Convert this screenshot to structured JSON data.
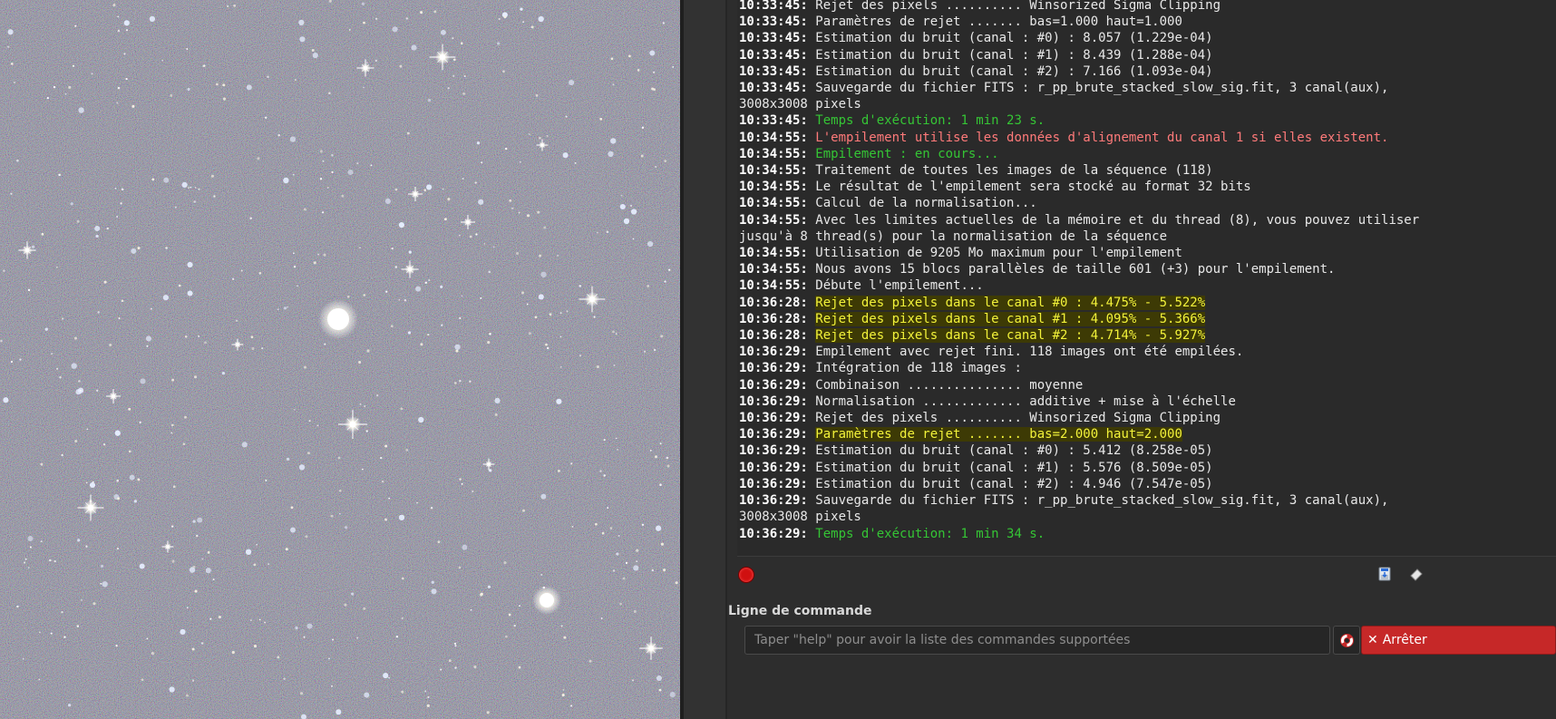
{
  "log": [
    {
      "ts": "10:33:45:",
      "msg": "Rejet des pixels .......... Winsorized Sigma Clipping",
      "style": "normal"
    },
    {
      "ts": "10:33:45:",
      "msg": "Paramètres de rejet ....... bas=1.000 haut=1.000",
      "style": "normal"
    },
    {
      "ts": "10:33:45:",
      "msg": "Estimation du bruit (canal : #0) : 8.057 (1.229e-04)",
      "style": "normal"
    },
    {
      "ts": "10:33:45:",
      "msg": "Estimation du bruit (canal : #1) : 8.439 (1.288e-04)",
      "style": "normal"
    },
    {
      "ts": "10:33:45:",
      "msg": "Estimation du bruit (canal : #2) : 7.166 (1.093e-04)",
      "style": "normal"
    },
    {
      "ts": "10:33:45:",
      "msg": "Sauvegarde du fichier FITS : r_pp_brute_stacked_slow_sig.fit, 3 canal(aux),",
      "style": "normal"
    },
    {
      "ts": "",
      "msg": "3008x3008 pixels",
      "style": "normal"
    },
    {
      "ts": "10:33:45:",
      "msg": "Temps d'exécution: 1 min 23 s.",
      "style": "green"
    },
    {
      "ts": "10:34:55:",
      "msg": "L'empilement utilise les données d'alignement du canal 1 si elles existent.",
      "style": "red"
    },
    {
      "ts": "10:34:55:",
      "msg": "Empilement : en cours...",
      "style": "green"
    },
    {
      "ts": "10:34:55:",
      "msg": "Traitement de toutes les images de la séquence (118)",
      "style": "normal"
    },
    {
      "ts": "10:34:55:",
      "msg": "Le résultat de l'empilement sera stocké au format 32 bits",
      "style": "normal"
    },
    {
      "ts": "10:34:55:",
      "msg": "Calcul de la normalisation...",
      "style": "normal"
    },
    {
      "ts": "10:34:55:",
      "msg": "Avec les limites actuelles de la mémoire et du thread (8), vous pouvez utiliser",
      "style": "normal"
    },
    {
      "ts": "",
      "msg": "jusqu'à 8 thread(s) pour la normalisation de la séquence",
      "style": "normal"
    },
    {
      "ts": "10:34:55:",
      "msg": "Utilisation de 9205 Mo maximum pour l'empilement",
      "style": "normal"
    },
    {
      "ts": "10:34:55:",
      "msg": "Nous avons 15 blocs parallèles de taille 601 (+3) pour l'empilement.",
      "style": "normal"
    },
    {
      "ts": "10:34:55:",
      "msg": "Débute l'empilement...",
      "style": "normal"
    },
    {
      "ts": "10:36:28:",
      "msg": "Rejet des pixels dans le canal #0 : 4.475% - 5.522%",
      "style": "highlight"
    },
    {
      "ts": "10:36:28:",
      "msg": "Rejet des pixels dans le canal #1 : 4.095% - 5.366%",
      "style": "highlight"
    },
    {
      "ts": "10:36:28:",
      "msg": "Rejet des pixels dans le canal #2 : 4.714% - 5.927%",
      "style": "highlight"
    },
    {
      "ts": "10:36:29:",
      "msg": "Empilement avec rejet fini. 118 images ont été empilées.",
      "style": "normal"
    },
    {
      "ts": "10:36:29:",
      "msg": "Intégration de 118 images :",
      "style": "normal"
    },
    {
      "ts": "10:36:29:",
      "msg": "Combinaison ............... moyenne",
      "style": "normal"
    },
    {
      "ts": "10:36:29:",
      "msg": "Normalisation ............. additive + mise à l'échelle",
      "style": "normal"
    },
    {
      "ts": "10:36:29:",
      "msg": "Rejet des pixels .......... Winsorized Sigma Clipping",
      "style": "normal"
    },
    {
      "ts": "10:36:29:",
      "msg": "Paramètres de rejet ....... bas=2.000 haut=2.000",
      "style": "highlight"
    },
    {
      "ts": "10:36:29:",
      "msg": "Estimation du bruit (canal : #0) : 5.412 (8.258e-05)",
      "style": "normal"
    },
    {
      "ts": "10:36:29:",
      "msg": "Estimation du bruit (canal : #1) : 5.576 (8.509e-05)",
      "style": "normal"
    },
    {
      "ts": "10:36:29:",
      "msg": "Estimation du bruit (canal : #2) : 4.946 (7.547e-05)",
      "style": "normal"
    },
    {
      "ts": "10:36:29:",
      "msg": "Sauvegarde du fichier FITS : r_pp_brute_stacked_slow_sig.fit, 3 canal(aux),",
      "style": "normal"
    },
    {
      "ts": "",
      "msg": "3008x3008 pixels",
      "style": "normal"
    },
    {
      "ts": "10:36:29:",
      "msg": "Temps d'exécution: 1 min 34 s.",
      "style": "green"
    }
  ],
  "command": {
    "label": "Ligne de commande",
    "placeholder": "Taper \"help\" pour avoir la liste des commandes supportées",
    "value": "",
    "stop_label": "Arrêter"
  },
  "colors": {
    "highlight_text": "#f2f23a",
    "green_text": "#35c535",
    "red_text": "#ff7a7a",
    "stop_button": "#c62828"
  },
  "icons": {
    "stop_dot": "red-stop-dot-icon",
    "save_log": "save-log-icon",
    "clear_log": "eraser-icon",
    "help": "lifebuoy-icon",
    "stop": "x-icon"
  }
}
